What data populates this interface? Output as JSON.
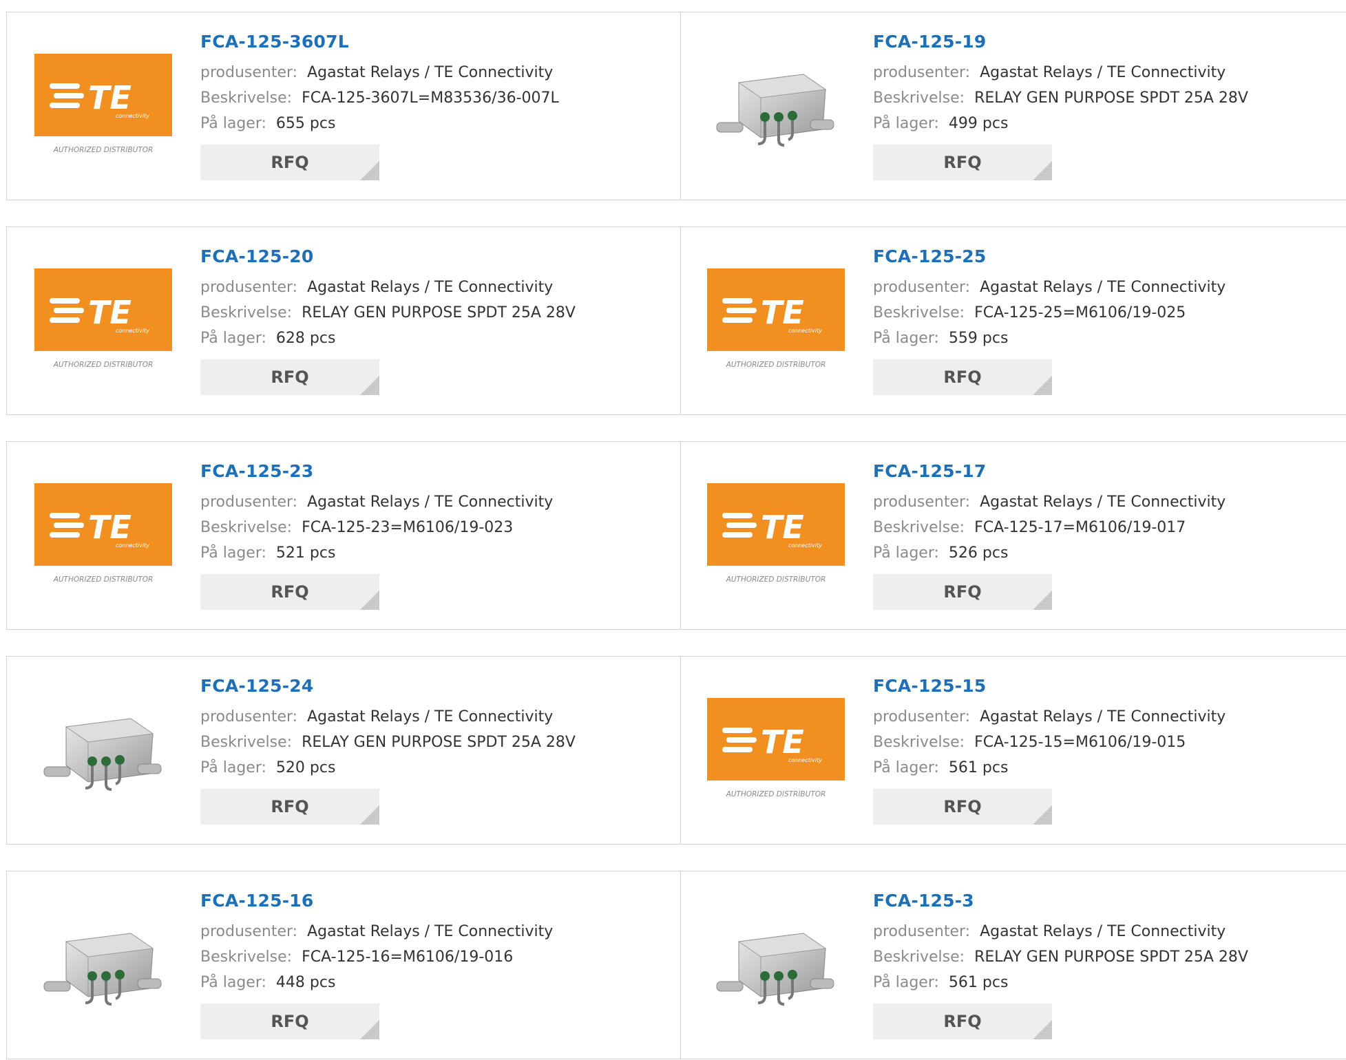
{
  "labels": {
    "manufacturer": "produsenter:",
    "description": "Beskrivelse:",
    "stock": "På lager:",
    "rfq": "RFQ"
  },
  "brand": {
    "orange": "#f18f21",
    "link_blue": "#1f6fb7",
    "logo_text": "TE",
    "logo_sub": "connectivity",
    "logo_caption": "AUTHORIZED DISTRIBUTOR"
  },
  "products": [
    {
      "part": "FCA-125-3607L",
      "manufacturer": "Agastat Relays / TE Connectivity",
      "description": "FCA-125-3607L=M83536/36-007L",
      "stock": "655 pcs",
      "image": "te-logo"
    },
    {
      "part": "FCA-125-19",
      "manufacturer": "Agastat Relays / TE Connectivity",
      "description": "RELAY GEN PURPOSE SPDT 25A 28V",
      "stock": "499 pcs",
      "image": "relay-photo"
    },
    {
      "part": "FCA-125-20",
      "manufacturer": "Agastat Relays / TE Connectivity",
      "description": "RELAY GEN PURPOSE SPDT 25A 28V",
      "stock": "628 pcs",
      "image": "te-logo"
    },
    {
      "part": "FCA-125-25",
      "manufacturer": "Agastat Relays / TE Connectivity",
      "description": "FCA-125-25=M6106/19-025",
      "stock": "559 pcs",
      "image": "te-logo"
    },
    {
      "part": "FCA-125-23",
      "manufacturer": "Agastat Relays / TE Connectivity",
      "description": "FCA-125-23=M6106/19-023",
      "stock": "521 pcs",
      "image": "te-logo"
    },
    {
      "part": "FCA-125-17",
      "manufacturer": "Agastat Relays / TE Connectivity",
      "description": "FCA-125-17=M6106/19-017",
      "stock": "526 pcs",
      "image": "te-logo"
    },
    {
      "part": "FCA-125-24",
      "manufacturer": "Agastat Relays / TE Connectivity",
      "description": "RELAY GEN PURPOSE SPDT 25A 28V",
      "stock": "520 pcs",
      "image": "relay-photo"
    },
    {
      "part": "FCA-125-15",
      "manufacturer": "Agastat Relays / TE Connectivity",
      "description": "FCA-125-15=M6106/19-015",
      "stock": "561 pcs",
      "image": "te-logo"
    },
    {
      "part": "FCA-125-16",
      "manufacturer": "Agastat Relays / TE Connectivity",
      "description": "FCA-125-16=M6106/19-016",
      "stock": "448 pcs",
      "image": "relay-photo"
    },
    {
      "part": "FCA-125-3",
      "manufacturer": "Agastat Relays / TE Connectivity",
      "description": "RELAY GEN PURPOSE SPDT 25A 28V",
      "stock": "561 pcs",
      "image": "relay-photo"
    }
  ]
}
